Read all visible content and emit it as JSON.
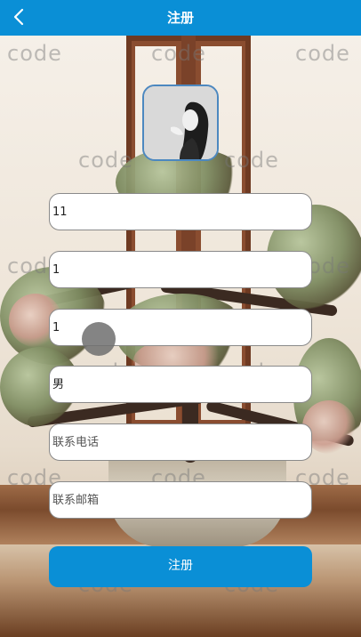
{
  "header": {
    "title": "注册",
    "back_icon": "chevron-left-icon",
    "background_color": "#0a8fd6"
  },
  "watermark": {
    "text": "code"
  },
  "form": {
    "fields": [
      {
        "value": "11",
        "placeholder": ""
      },
      {
        "value": "1",
        "placeholder": ""
      },
      {
        "value": "1",
        "placeholder": ""
      },
      {
        "value": "男",
        "placeholder": ""
      },
      {
        "value": "",
        "placeholder": "联系电话"
      },
      {
        "value": "",
        "placeholder": "联系邮箱"
      }
    ],
    "submit_label": "注册",
    "submit_color": "#0a8fd6"
  }
}
